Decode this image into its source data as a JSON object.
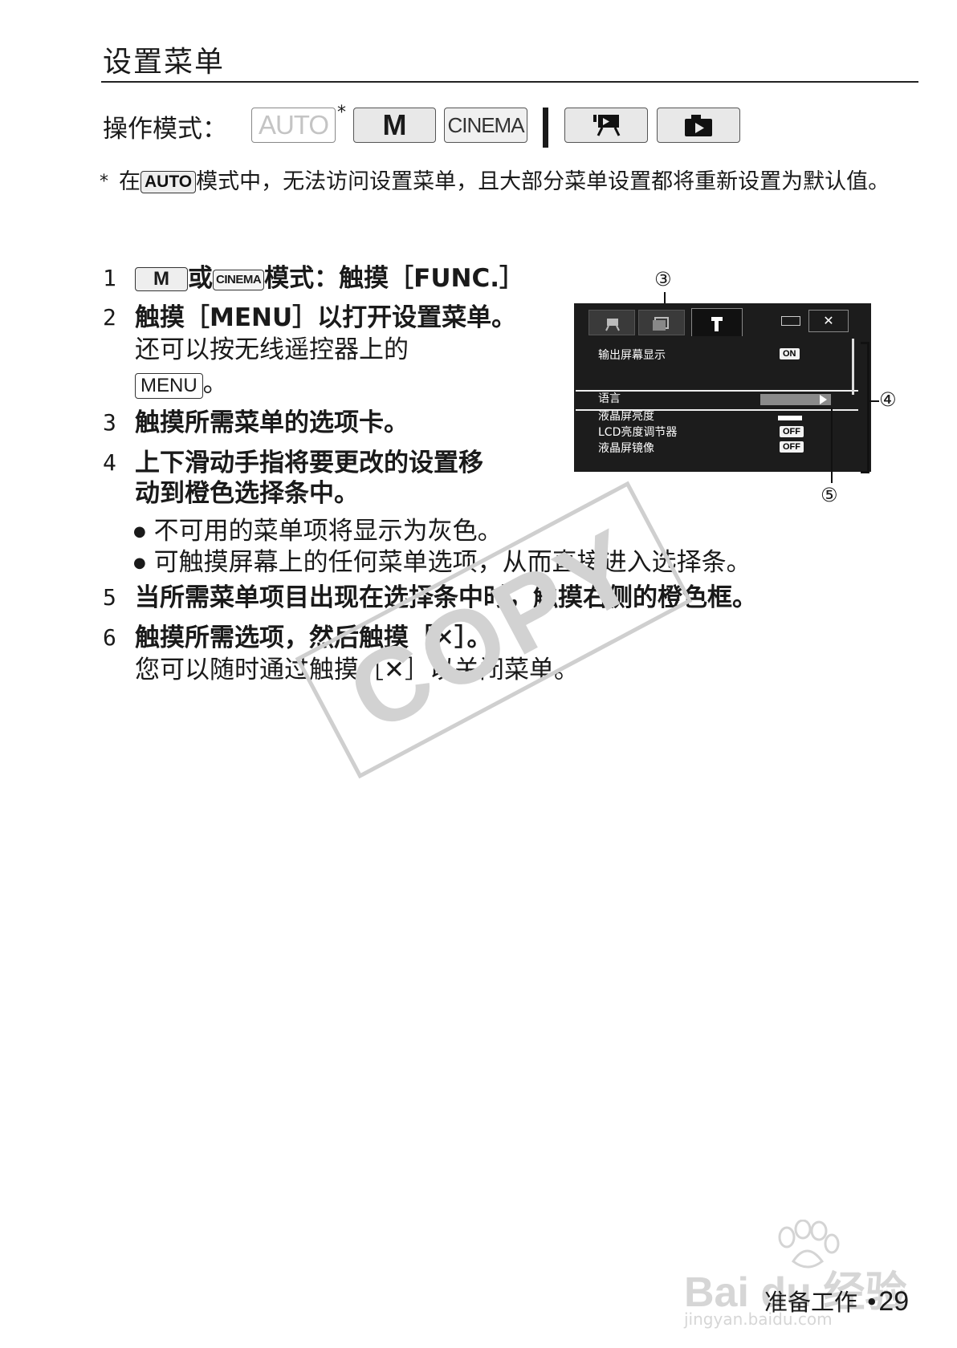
{
  "page": {
    "title": "设置菜单",
    "modes_label": "操作模式：",
    "modes": [
      "AUTO",
      "M",
      "CINEMA"
    ],
    "mode_asterisk": "*",
    "note_star": "*",
    "note_before": "在",
    "note_auto": "AUTO",
    "note_after": "模式中，无法访问设置菜单，且大部分菜单设置都将重新设置为默认值。",
    "steps": [
      {
        "num": "1",
        "m": "M",
        "or": "或",
        "cinema": "CINEMA",
        "text": "模式：触摸［FUNC.］"
      },
      {
        "num": "2",
        "text": "触摸［MENU］以打开设置菜单。",
        "sub1": "还可以按无线遥控器上的",
        "menu_key": "MENU",
        "sub2_end": "。"
      },
      {
        "num": "3",
        "text": "触摸所需菜单的选项卡。"
      },
      {
        "num": "4",
        "text": "上下滑动手指将要更改的设置移",
        "text2": "动到橙色选择条中。",
        "bullets": [
          "不可用的菜单项将显示为灰色。",
          "可触摸屏幕上的任何菜单选项，从而直接进入选择条。"
        ]
      },
      {
        "num": "5",
        "text": "当所需菜单项目出现在选择条中时，触摸右侧的橙色框。"
      },
      {
        "num": "6",
        "text_a": "触摸所需选项，然后触摸［",
        "x": "✕",
        "text_b": "］。",
        "sub_a": "您可以随时通过触摸［",
        "sub_b": "］以关闭菜单。"
      }
    ],
    "bullet_mark": "●",
    "screen": {
      "items": [
        "输出屏幕显示",
        "语言",
        "液晶屏亮度",
        "LCD亮度调节器",
        "液晶屏镜像"
      ],
      "values": [
        "ON",
        "OFF",
        "OFF"
      ],
      "close": "✕",
      "callouts": [
        "③",
        "④",
        "⑤"
      ]
    },
    "watermark": "COPY",
    "baidu_text": "Bai du 经验",
    "baidu_url": "jingyan.baidu.com",
    "footer_text": "准备工作",
    "footer_sep": "•",
    "page_number": "29"
  }
}
